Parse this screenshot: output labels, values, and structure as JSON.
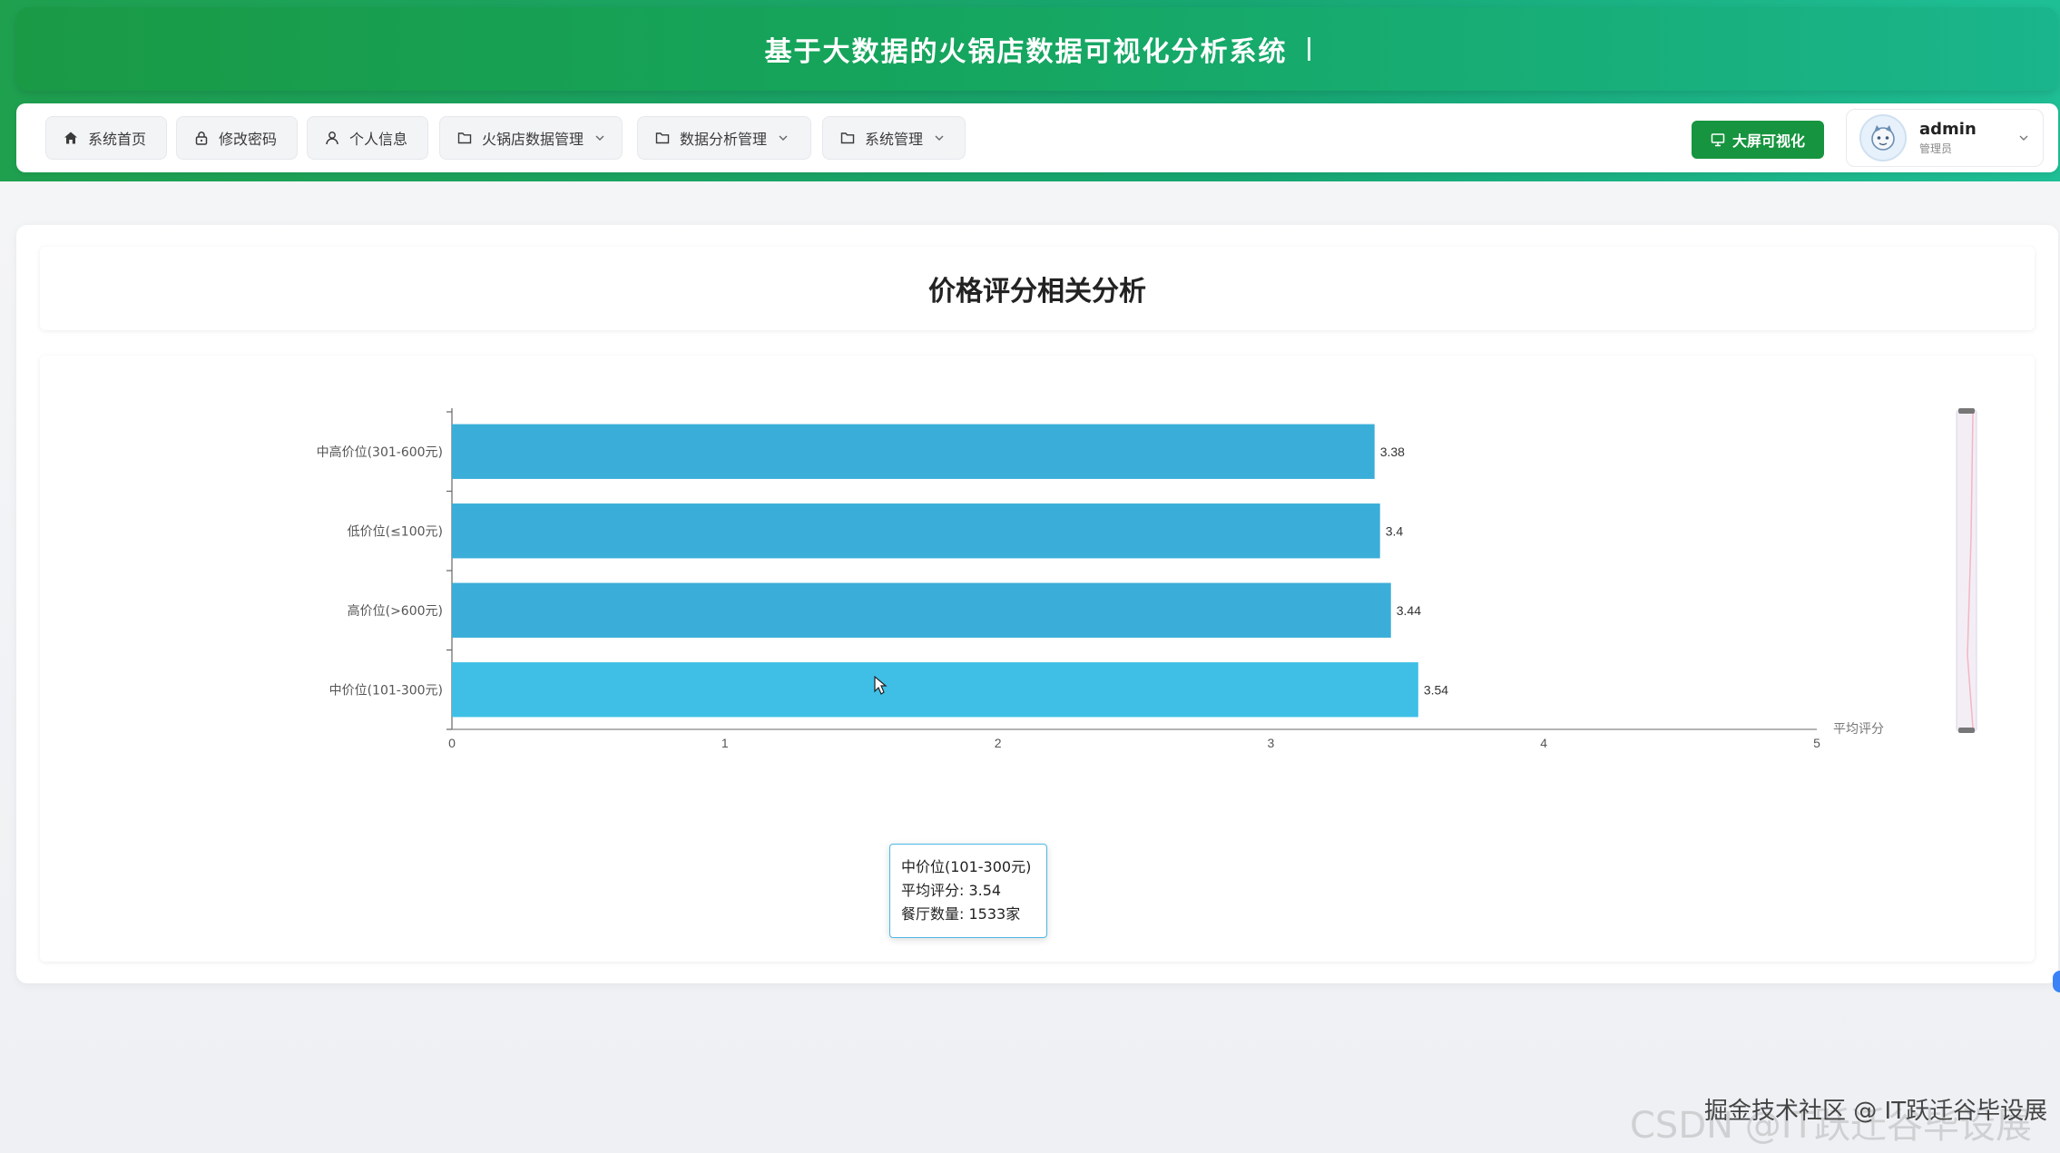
{
  "header": {
    "title": "基于大数据的火锅店数据可视化分析系统"
  },
  "nav": {
    "items": [
      {
        "label": "系统首页",
        "icon": "home-icon",
        "has_dropdown": false
      },
      {
        "label": "修改密码",
        "icon": "lock-icon",
        "has_dropdown": false
      },
      {
        "label": "个人信息",
        "icon": "user-icon",
        "has_dropdown": false
      },
      {
        "label": "火锅店数据管理",
        "icon": "folder-icon",
        "has_dropdown": true
      },
      {
        "label": "数据分析管理",
        "icon": "folder-icon",
        "has_dropdown": true
      },
      {
        "label": "系统管理",
        "icon": "folder-icon",
        "has_dropdown": true
      }
    ],
    "big_screen_label": "大屏可视化",
    "user": {
      "name": "admin",
      "role": "管理员"
    }
  },
  "page": {
    "title": "价格评分相关分析"
  },
  "chart_data": {
    "type": "bar",
    "orientation": "horizontal",
    "categories": [
      "中高价位(301-600元)",
      "低价位(≤100元)",
      "高价位(>600元)",
      "中价位(101-300元)"
    ],
    "values": [
      3.38,
      3.4,
      3.44,
      3.54
    ],
    "value_labels": [
      "3.38",
      "3.4",
      "3.44",
      "3.54"
    ],
    "xlabel": "平均评分",
    "xlim": [
      0,
      5
    ],
    "x_ticks": [
      "0",
      "1",
      "2",
      "3",
      "4",
      "5"
    ],
    "bar_color": "#3aaed8",
    "highlight_color": "#3fbfe6",
    "highlighted_index": 3
  },
  "tooltip": {
    "title": "中价位(101-300元)",
    "line1": "平均评分: 3.54",
    "line2": "餐厅数量: 1533家"
  },
  "watermark": {
    "back": "CSDN @IT跃迁谷毕设展",
    "front": "掘金技术社区 @ IT跃迁谷毕设展"
  }
}
